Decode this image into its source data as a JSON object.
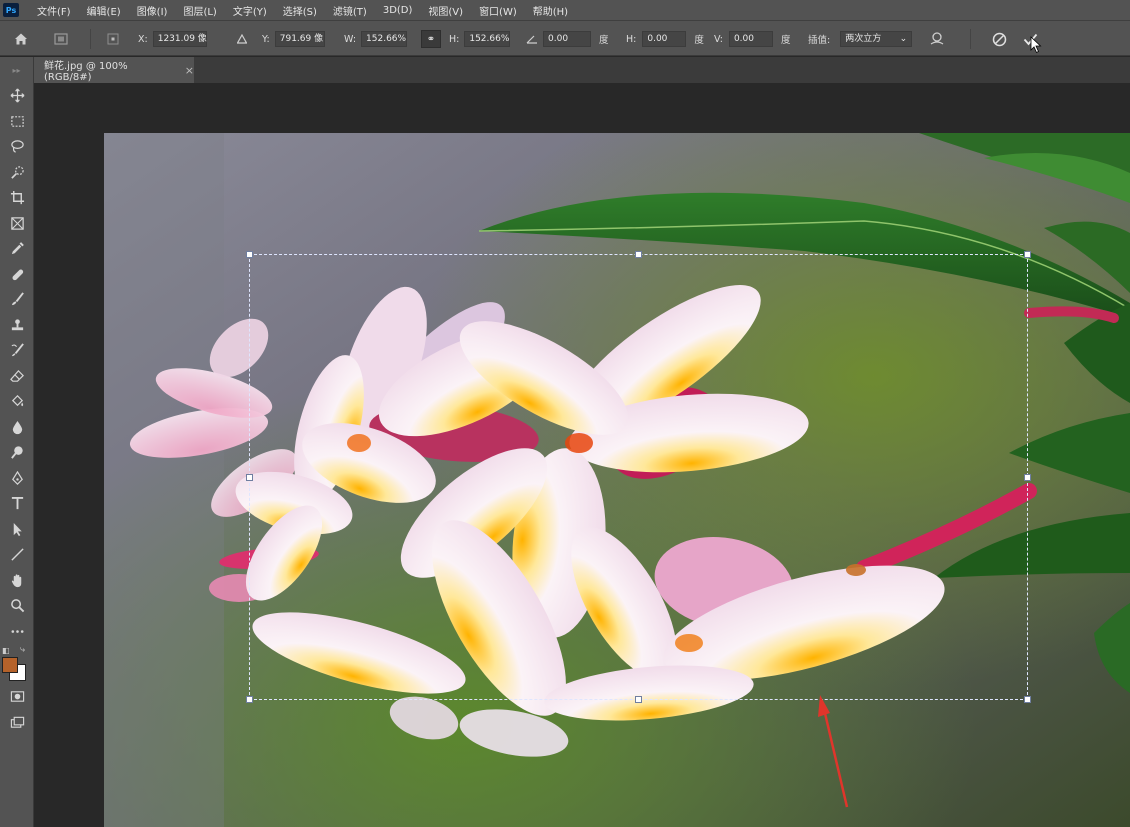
{
  "app": {
    "logo_text": "Ps"
  },
  "menu": {
    "items": [
      "文件(F)",
      "编辑(E)",
      "图像(I)",
      "图层(L)",
      "文字(Y)",
      "选择(S)",
      "滤镜(T)",
      "3D(D)",
      "视图(V)",
      "窗口(W)",
      "帮助(H)"
    ]
  },
  "options": {
    "x_label": "X:",
    "x_value": "1231.09 像",
    "y_label": "Y:",
    "y_value": "791.69 像",
    "w_label": "W:",
    "w_value": "152.66%",
    "h_label": "H:",
    "h_value": "152.66%",
    "angle_value": "0.00",
    "angle_unit": "度",
    "hskew_label": "H:",
    "hskew_value": "0.00",
    "hskew_unit": "度",
    "vskew_label": "V:",
    "vskew_value": "0.00",
    "vskew_unit": "度",
    "interp_label": "插值:",
    "interp_value": "两次立方"
  },
  "document": {
    "tab_label": "鲜花.jpg @ 100%(RGB/8#)",
    "tab_close": "×"
  },
  "tools": [
    "move-tool",
    "marquee-tool",
    "lasso-tool",
    "quick-select-tool",
    "crop-tool",
    "frame-tool",
    "eyedropper-tool",
    "healing-brush-tool",
    "brush-tool",
    "clone-stamp-tool",
    "history-brush-tool",
    "eraser-tool",
    "paint-bucket-tool",
    "blur-tool",
    "dodge-tool",
    "pen-tool",
    "type-tool",
    "path-select-tool",
    "line-tool",
    "hand-tool",
    "zoom-tool",
    "more-tools"
  ],
  "colors": {
    "foreground": "#b5622a",
    "background": "#ffffff",
    "arrow": "#e0352b"
  }
}
